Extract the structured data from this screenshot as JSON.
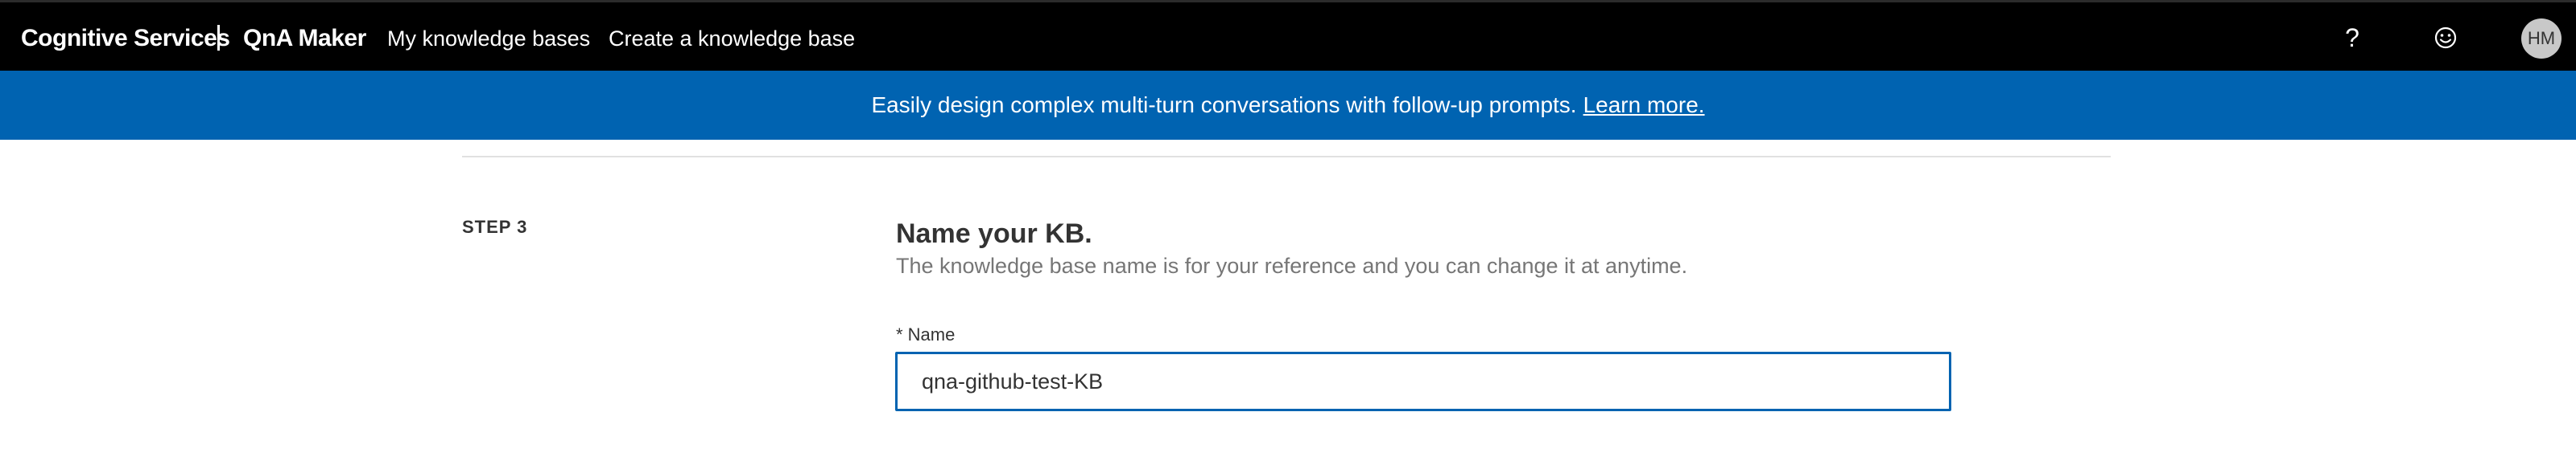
{
  "nav": {
    "brand": "Cognitive Services",
    "product": "QnA Maker",
    "links": [
      {
        "label": "My knowledge bases"
      },
      {
        "label": "Create a knowledge base"
      }
    ],
    "help_glyph": "?",
    "avatar_initials": "HM"
  },
  "banner": {
    "text": "Easily design complex multi-turn conversations with follow-up prompts.",
    "link": "Learn more."
  },
  "step": {
    "label": "STEP 3",
    "title": "Name your KB.",
    "description": "The knowledge base name is for your reference and you can change it at anytime.",
    "field_label": "* Name",
    "field_value": "qna-github-test-KB"
  },
  "colors": {
    "nav_bg": "#000000",
    "banner_bg": "#0063b1",
    "input_border": "#0063b1"
  },
  "icons": {
    "help": "help-icon",
    "feedback": "smile-icon"
  }
}
